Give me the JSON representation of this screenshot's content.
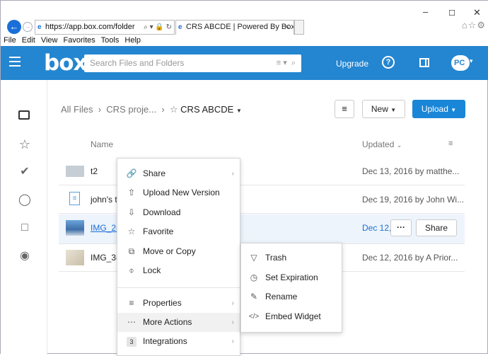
{
  "browser": {
    "url": "https://app.box.com/folder",
    "tab_title": "CRS ABCDE | Powered By Box",
    "menu": [
      "File",
      "Edit",
      "View",
      "Favorites",
      "Tools",
      "Help"
    ]
  },
  "header": {
    "logo": "box",
    "search_placeholder": "Search Files and Folders",
    "upgrade": "Upgrade",
    "avatar": "PC"
  },
  "breadcrumb": {
    "root": "All Files",
    "parent": "CRS proje...",
    "current": "CRS ABCDE"
  },
  "toolbar": {
    "new": "New",
    "upload": "Upload"
  },
  "columns": {
    "name": "Name",
    "updated": "Updated"
  },
  "files": [
    {
      "name": "t2",
      "updated": "Dec 13, 2016 by matthe..."
    },
    {
      "name": "john's t",
      "updated": "Dec 19, 2016 by John Wi..."
    },
    {
      "name": "IMG_2(",
      "updated": "Dec 12,"
    },
    {
      "name": "IMG_3(",
      "updated": "Dec 12, 2016 by A Prior..."
    }
  ],
  "row_actions": {
    "more": "···",
    "share": "Share"
  },
  "context_menu": {
    "items": [
      "Share",
      "Upload New Version",
      "Download",
      "Favorite",
      "Move or Copy",
      "Lock",
      "Properties",
      "More Actions",
      "Integrations"
    ],
    "integrations_count": "3"
  },
  "submenu": {
    "items": [
      "Trash",
      "Set Expiration",
      "Rename",
      "Embed Widget"
    ]
  },
  "colors": {
    "brand": "#2486d0",
    "upload": "#1a86d8"
  }
}
